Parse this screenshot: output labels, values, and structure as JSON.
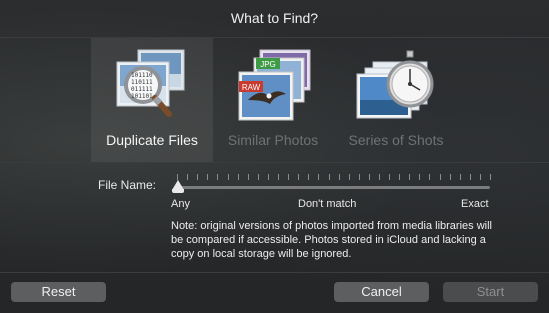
{
  "dialog": {
    "title": "What to Find?"
  },
  "options": [
    {
      "label": "Duplicate Files",
      "selected": true,
      "icon": "duplicate-files-icon"
    },
    {
      "label": "Similar Photos",
      "selected": false,
      "icon": "similar-photos-icon"
    },
    {
      "label": "Series of Shots",
      "selected": false,
      "icon": "series-of-shots-icon"
    }
  ],
  "similar_icon": {
    "jpg_tag": "JPG",
    "raw_tag": "RAW"
  },
  "duplicate_icon": {
    "binary_text": "101110 110111 011111 101101 110010"
  },
  "filename": {
    "label": "File Name:",
    "scale_min": "Any",
    "scale_mid": "Don't match",
    "scale_max": "Exact",
    "value_fraction": 0
  },
  "note": "Note: original versions of photos imported from media libraries will be compared if accessible. Photos stored in iCloud and lacking a copy on local storage will be ignored.",
  "buttons": {
    "reset": "Reset",
    "cancel": "Cancel",
    "start": "Start"
  },
  "colors": {
    "background": "#27292b",
    "selected_bg": "#3d3f40",
    "button_bg": "#5c5e60",
    "disabled_text": "#8d8f91"
  }
}
